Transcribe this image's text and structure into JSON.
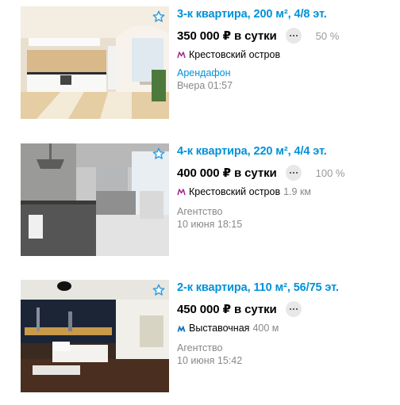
{
  "colors": {
    "link": "#0091d9",
    "muted": "#888888",
    "metro_purple": "#a1288a",
    "metro_blue": "#0a6fc2"
  },
  "listings": [
    {
      "title": "3-к квартира, 200 м², 4/8 эт.",
      "price": "350 000 ₽ в сутки",
      "percent": "50 %",
      "metro_icon": "metro-purple-icon",
      "metro": "Крестовский остров",
      "distance": "",
      "seller": "Арендафон",
      "date": "Вчера 01:57"
    },
    {
      "title": "4-к квартира, 220 м², 4/4 эт.",
      "price": "400 000 ₽ в сутки",
      "percent": "100 %",
      "metro_icon": "metro-purple-icon",
      "metro": "Крестовский остров",
      "distance": "1.9 км",
      "seller": "Агентство",
      "date": "10 июня 18:15"
    },
    {
      "title": "2-к квартира, 110 м², 56/75 эт.",
      "price": "450 000 ₽ в сутки",
      "percent": "",
      "metro_icon": "metro-blue-icon",
      "metro": "Выставочная",
      "distance": "400 м",
      "seller": "Агентство",
      "date": "10 июня 15:42"
    }
  ]
}
